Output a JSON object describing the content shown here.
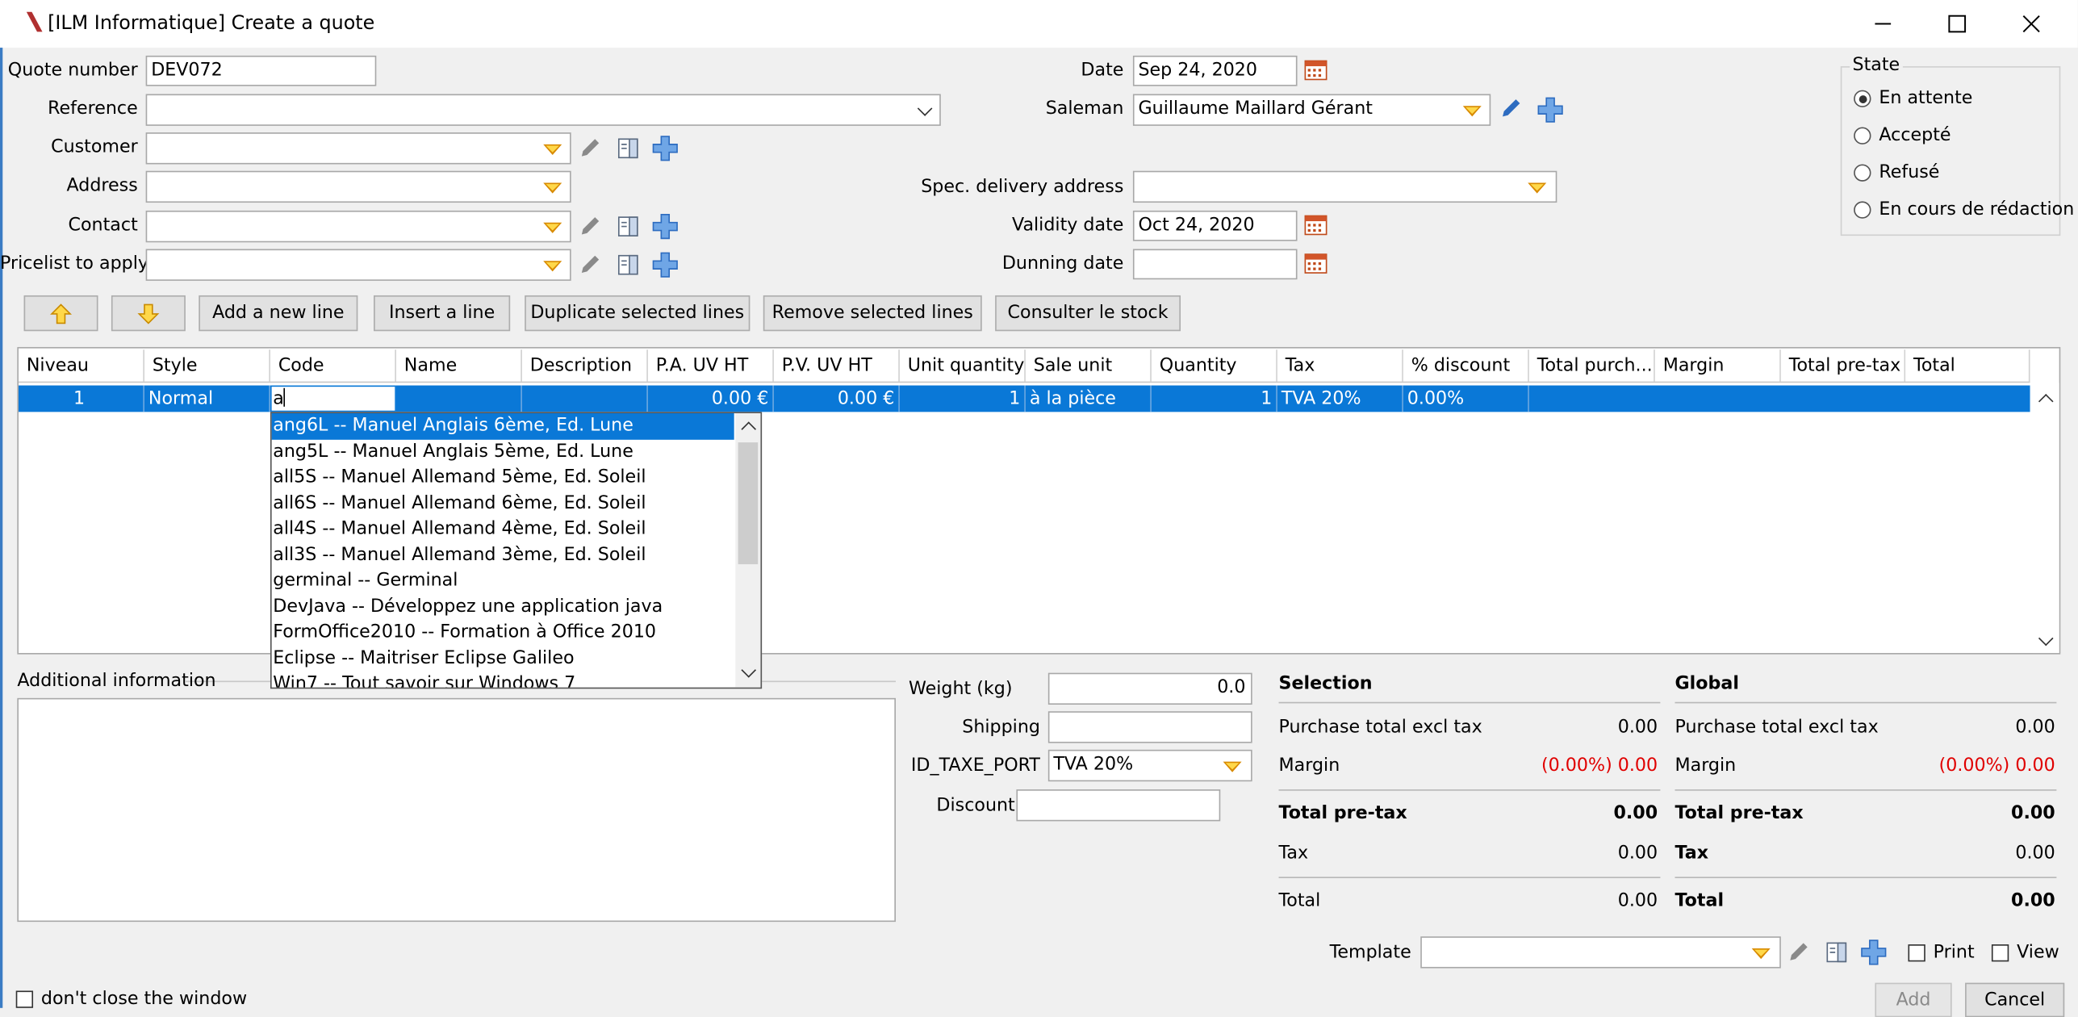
{
  "window": {
    "title": "[ILM Informatique] Create a quote"
  },
  "header": {
    "quote_number_label": "Quote number",
    "quote_number_value": "DEV072",
    "reference_label": "Reference",
    "reference_value": "",
    "customer_label": "Customer",
    "address_label": "Address",
    "contact_label": "Contact",
    "pricelist_label": "Pricelist to apply",
    "date_label": "Date",
    "date_value": "Sep 24, 2020",
    "salesman_label": "Saleman",
    "salesman_value": "Guillaume Maillard Gérant",
    "spec_delivery_label": "Spec. delivery address",
    "validity_label": "Validity date",
    "validity_value": "Oct 24, 2020",
    "dunning_label": "Dunning date",
    "dunning_value": ""
  },
  "state": {
    "title": "State",
    "options": [
      "En attente",
      "Accepté",
      "Refusé",
      "En cours de rédaction"
    ],
    "selected": "En attente"
  },
  "toolbar": {
    "add_line": "Add a new line",
    "insert_line": "Insert a line",
    "duplicate": "Duplicate selected lines",
    "remove": "Remove selected lines",
    "stock": "Consulter le stock"
  },
  "table": {
    "columns": [
      "Niveau",
      "Style",
      "Code",
      "Name",
      "Description",
      "P.A. UV HT",
      "P.V. UV HT",
      "Unit quantity",
      "Sale unit",
      "Quantity",
      "Tax",
      "% discount",
      "Total purch...",
      "Margin",
      "Total pre-tax",
      "Total"
    ],
    "row": {
      "niveau": "1",
      "style": "Normal",
      "code": "a",
      "name": "",
      "description": "",
      "pa": "0.00 €",
      "pv": "0.00 €",
      "unit_qty": "1",
      "sale_unit": "à la pièce",
      "quantity": "1",
      "tax": "TVA 20%",
      "discount": "0.00%"
    }
  },
  "dropdown": {
    "items": [
      "ang6L -- Manuel Anglais 6ème, Ed. Lune",
      "ang5L -- Manuel Anglais 5ème, Ed. Lune",
      "all5S -- Manuel Allemand 5ème, Ed. Soleil",
      "all6S -- Manuel Allemand 6ème, Ed. Soleil",
      "all4S -- Manuel Allemand 4ème, Ed. Soleil",
      "all3S -- Manuel Allemand 3ème, Ed. Soleil",
      "germinal -- Germinal",
      "DevJava -- Développez une application java",
      "FormOffice2010 -- Formation à Office 2010",
      "Eclipse -- Maitriser Eclipse Galileo",
      "Win7 -- Tout savoir sur Windows 7"
    ]
  },
  "additional": {
    "label": "Additional information"
  },
  "shipping": {
    "weight_label": "Weight (kg)",
    "weight_value": "0.0",
    "shipping_label": "Shipping",
    "shipping_value": "",
    "tax_label": "ID_TAXE_PORT",
    "tax_value": "TVA 20%",
    "discount_label": "Discount",
    "discount_value": ""
  },
  "selection": {
    "title": "Selection",
    "purchase_label": "Purchase total excl tax",
    "purchase_value": "0.00",
    "margin_label": "Margin",
    "margin_value": "(0.00%) 0.00",
    "pretax_label": "Total pre-tax",
    "pretax_value": "0.00",
    "tax_label": "Tax",
    "tax_value": "0.00",
    "total_label": "Total",
    "total_value": "0.00"
  },
  "global": {
    "title": "Global",
    "purchase_label": "Purchase total excl tax",
    "purchase_value": "0.00",
    "margin_label": "Margin",
    "margin_value": "(0.00%) 0.00",
    "pretax_label": "Total pre-tax",
    "pretax_value": "0.00",
    "tax_label": "Tax",
    "tax_value": "0.00",
    "total_label": "Total",
    "total_value": "0.00"
  },
  "footer": {
    "template_label": "Template",
    "print_label": "Print",
    "view_label": "View",
    "dont_close": "don't close the window",
    "add": "Add",
    "cancel": "Cancel"
  },
  "colors": {
    "selection_blue": "#0a78d7",
    "icon_blue": "#3a7fd5",
    "margin_red": "#e00000"
  }
}
